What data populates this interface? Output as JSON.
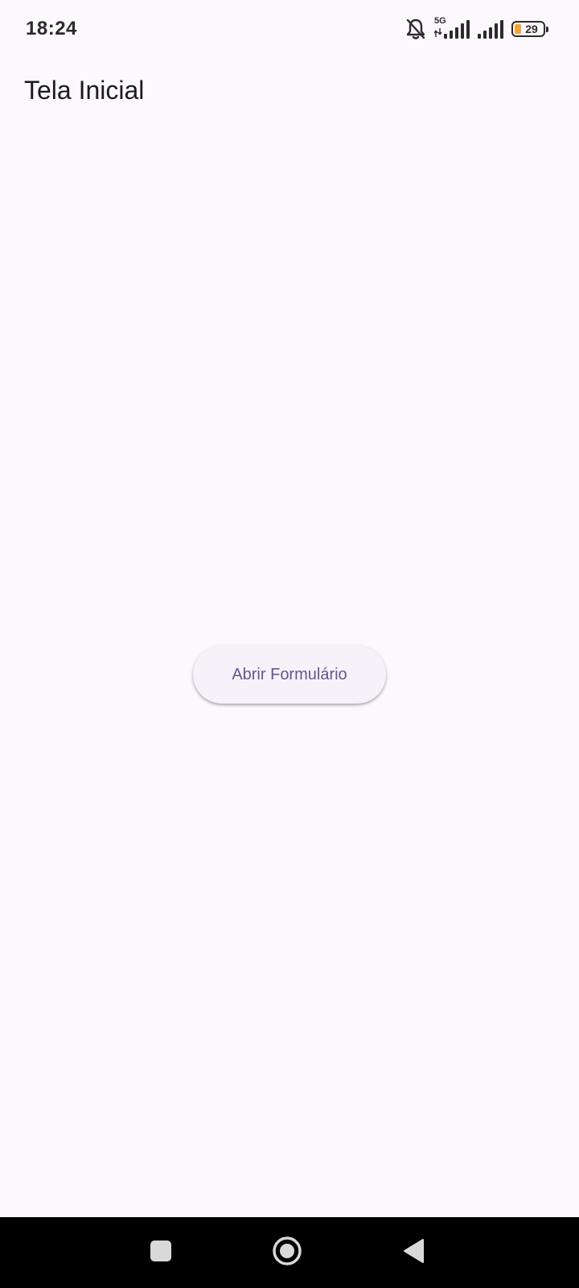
{
  "status_bar": {
    "time": "18:24",
    "network_type": "5G",
    "battery_level": "29",
    "icons": [
      "bell-off-icon",
      "signal-icon",
      "signal-icon",
      "battery-icon"
    ],
    "battery_fill_color": "#f2a531"
  },
  "app_bar": {
    "title": "Tela Inicial"
  },
  "main": {
    "open_form_button_label": "Abrir Formulário"
  },
  "nav_bar": {
    "icons": [
      "recents-icon",
      "home-icon",
      "back-icon"
    ]
  },
  "colors": {
    "background": "#fdf7fe",
    "button_background": "#f7f2fa",
    "button_text": "#65558f",
    "nav_background": "#000000"
  }
}
